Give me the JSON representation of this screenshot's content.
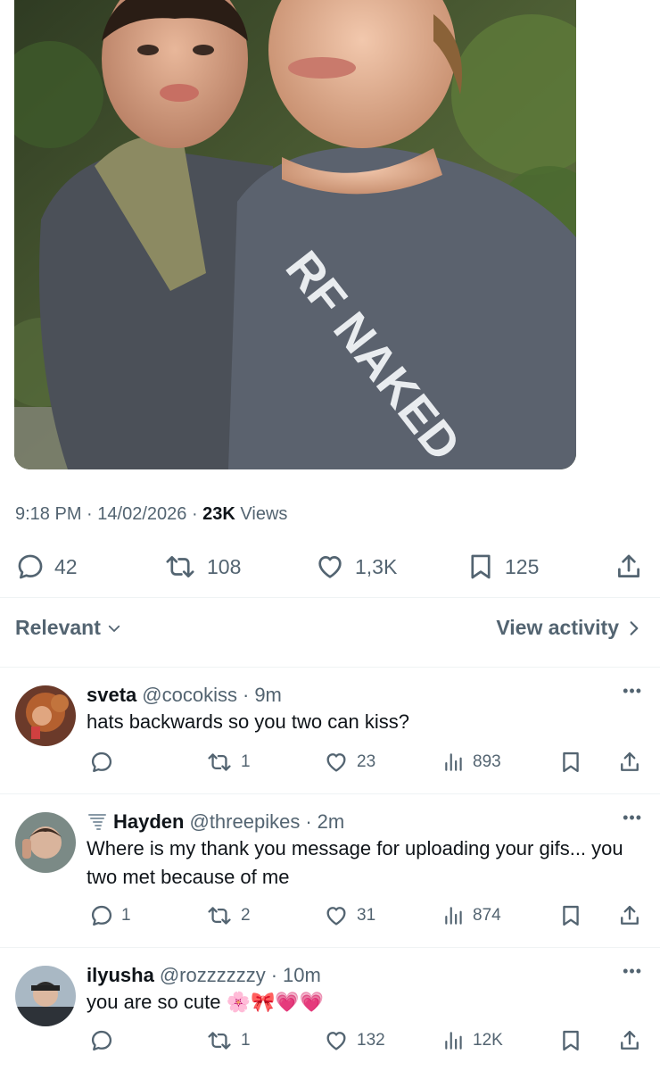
{
  "tweet": {
    "shirt_text": "RF NAKED",
    "time": "9:18 PM",
    "date": "14/02/2026",
    "views_count": "23K",
    "views_label": "Views",
    "actions": {
      "replies": "42",
      "reposts": "108",
      "likes": "1,3K",
      "bookmarks": "125"
    }
  },
  "filter": {
    "sort_label": "Relevant",
    "view_activity_label": "View activity"
  },
  "replies": [
    {
      "name": "sveta",
      "handle": "@cocokiss",
      "time": "9m",
      "text": "hats backwards so you two can kiss?",
      "replies": "",
      "reposts": "1",
      "likes": "23",
      "views": "893"
    },
    {
      "name": "Hayden",
      "handle": "@threepikes",
      "time": "2m",
      "text": "Where is my thank you message for uploading your gifs... you two met because of me",
      "replies": "1",
      "reposts": "2",
      "likes": "31",
      "views": "874"
    },
    {
      "name": "ilyusha",
      "handle": "@rozzzzzzy",
      "time": "10m",
      "text": "you are so cute",
      "emojis": "🌸🎀💗💗",
      "replies": "",
      "reposts": "1",
      "likes": "132",
      "views": "12K"
    }
  ],
  "colors": {
    "text_primary": "#0f1419",
    "text_secondary": "#536471",
    "divider": "#eff3f4"
  },
  "icons": [
    "reply-icon",
    "repost-icon",
    "like-icon",
    "bookmark-icon",
    "share-icon",
    "views-icon",
    "chevron-down-icon",
    "chevron-right-icon",
    "more-icon",
    "tornado-icon"
  ]
}
